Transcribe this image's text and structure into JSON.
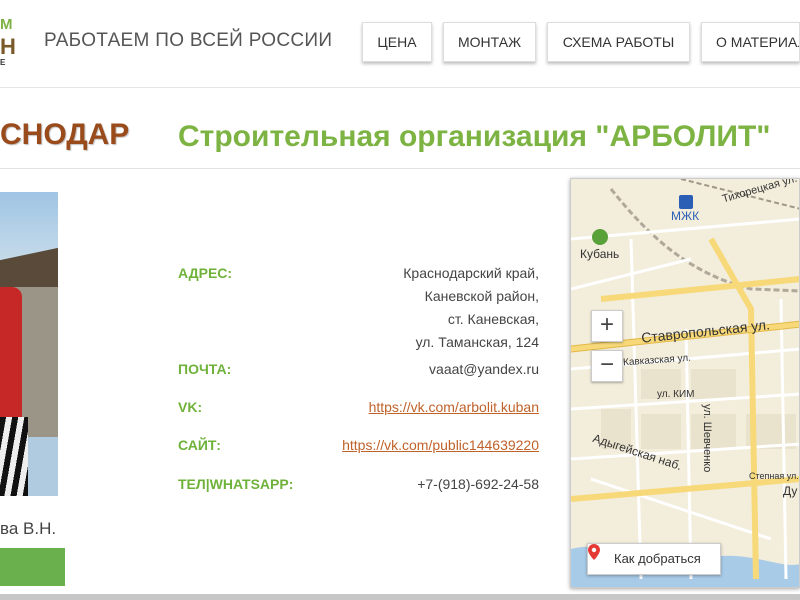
{
  "header": {
    "logo": {
      "line1": "М",
      "line2": "Н",
      "line3": "Е"
    },
    "slogan": "РАБОТАЕМ ПО ВСЕЙ РОССИИ",
    "nav": [
      "ЦЕНА",
      "МОНТАЖ",
      "СХЕМА РАБОТЫ",
      "О МАТЕРИАЛЕ"
    ]
  },
  "page": {
    "city_title": "СНОДАР",
    "org_title": "Строительная организация \"АРБОЛИТ\""
  },
  "person": {
    "caption": "ва В.Н."
  },
  "contacts": {
    "address_label": "АДРЕС:",
    "address_lines": [
      "Краснодарский край,",
      "Каневской район,",
      "ст. Каневская,",
      "ул. Таманская, 124"
    ],
    "email_label": "ПОЧТА:",
    "email": "vaaat@yandex.ru",
    "vk_label": "VK:",
    "vk": "https://vk.com/arbolit.kuban",
    "site_label": "САЙТ:",
    "site": "https://vk.com/public144639220",
    "phone_label": "ТЕЛ|WHATSAPP:",
    "phone": "+7-(918)-692-24-58"
  },
  "map": {
    "zoom_in": "+",
    "zoom_out": "−",
    "route_button": "Как добраться",
    "labels": {
      "tikhoretskaya": "Тихорецкая ул.",
      "mzhk": "МЖК",
      "kuban": "Кубань",
      "stavropolskaya": "Ставропольская ул.",
      "kavkazskaya": "Кавказская ул.",
      "kim": "ул. КИМ",
      "shevchenko": "ул. Шевченко",
      "adygeyskaya": "Адыгейская наб.",
      "stepnaya": "Степная ул.",
      "du": "Ду"
    }
  },
  "colors": {
    "brand_green": "#7cb342",
    "title_brown": "#9a4b1c",
    "link": "#c0622a"
  }
}
